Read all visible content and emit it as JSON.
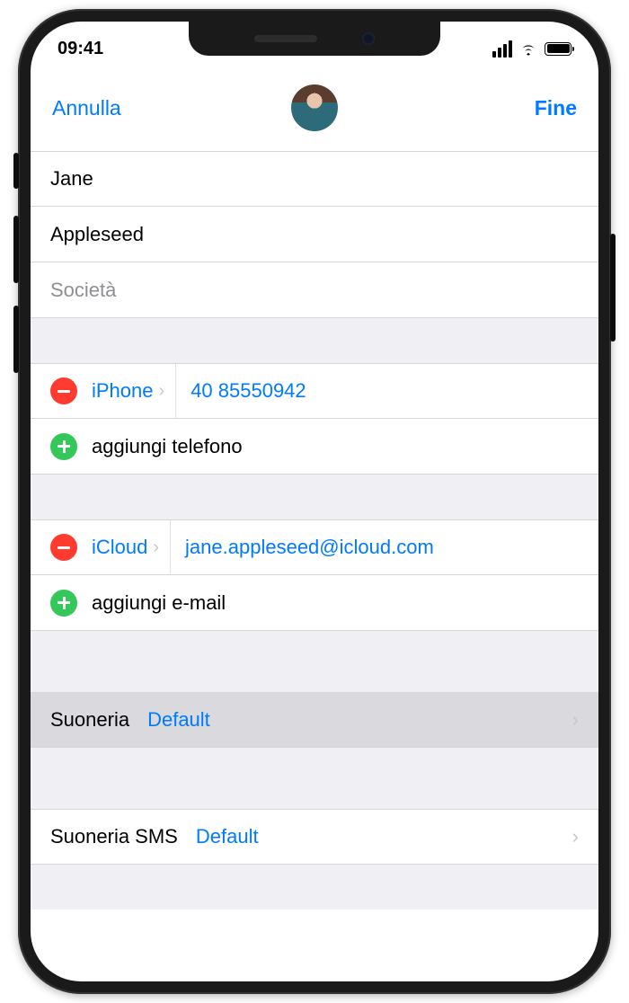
{
  "status": {
    "time": "09:41"
  },
  "nav": {
    "cancel": "Annulla",
    "done": "Fine"
  },
  "name": {
    "first": "Jane",
    "last": "Appleseed",
    "company_placeholder": "Società"
  },
  "phone": {
    "type_label": "iPhone",
    "number": "40 85550942",
    "add_label": "aggiungi telefono"
  },
  "email": {
    "type_label": "iCloud",
    "address": "jane.appleseed@icloud.com",
    "add_label": "aggiungi e-mail"
  },
  "ringtone": {
    "label": "Suoneria",
    "value": "Default"
  },
  "text_tone": {
    "label": "Suoneria SMS",
    "value": "Default"
  }
}
